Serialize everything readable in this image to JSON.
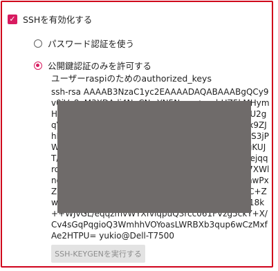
{
  "ssh_enable": {
    "label": "SSHを有効化する",
    "checked": true
  },
  "auth_options": [
    {
      "label": "パスワード認証を使う",
      "selected": false
    },
    {
      "label": "公開鍵認証のみを許可する",
      "selected": true
    }
  ],
  "authorized_keys": {
    "title": "ユーザーraspiのためのauthorized_keys",
    "value": "ssh-rsa AAAAB3NzaC1yc2EAAAADAQABAAABgQCy9v0iVe8aM3XDAdj4NpCNwYN5Nwca+smbHZ5kMHymHnjZJR6MMJ8J1Zgs6BBDczuAUe/1LN+sM8se+jdU2gqVXcBXU5q51j59ccyxYPm6uhyES53hmV2J7B/hx9ZJhN4VDutXU4FBT0hue5zKt2QEdOty4DTHi4+4B1S3jPW0BO+lInMns8f8xv4Bn2UbHznxK4/tIDLyStUeugKUJT/1ZEgTkYYYUPf7N/Lp4/Kbk16u603aff3w85w2AejqqromMJkUt4dGLTRt58mZIgWX33GF/PmbgDjSJBX7XWlnqlZCCA2PbuZJF2cbXI8ttSTGCtEJWUyOdM0skTnwPxZcvTM6Zg6sKqdbIOC9Co25yQQuxMbFjABJvs8bC+ZwvuMi92RcyLNKzvNl4/dOthBH+p3AMObR0zUjb18k++WJvGL/eqqzmvWYXfviqpuQ3rcc061FVzg5ckY+X/Cv4sGqPqgioQ3WmhhVOYoasLWRBXb3qup6wCzMxfAe2HTPU= yukio@Dell-T7500"
  },
  "generate_button": {
    "label": "SSH-KEYGENを実行する"
  }
}
